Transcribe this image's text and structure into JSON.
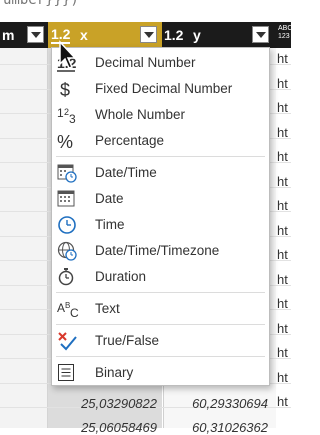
{
  "formula_fragment": "umber}}})",
  "header": {
    "left_col_label": "m",
    "x_col": {
      "type_badge": "1.2",
      "label": "x"
    },
    "y_col": {
      "type_badge": "1.2",
      "label": "y"
    },
    "url_col_badge_top": "ABC",
    "url_col_badge_bottom": "123"
  },
  "rows": {
    "cell_prefix": "ht",
    "bottom_rows": [
      {
        "x": "25,03290822",
        "y": "60,29330694"
      },
      {
        "x": "25,06058469",
        "y": "60,31026362"
      }
    ]
  },
  "menu": {
    "items": [
      {
        "label": "Decimal Number",
        "icon": "decimal-number-icon"
      },
      {
        "label": "Fixed Decimal Number",
        "icon": "fixed-decimal-icon"
      },
      {
        "label": "Whole Number",
        "icon": "whole-number-icon"
      },
      {
        "label": "Percentage",
        "icon": "percentage-icon"
      },
      {
        "label": "Date/Time",
        "icon": "datetime-icon"
      },
      {
        "label": "Date",
        "icon": "date-icon"
      },
      {
        "label": "Time",
        "icon": "time-icon"
      },
      {
        "label": "Date/Time/Timezone",
        "icon": "datetime-timezone-icon"
      },
      {
        "label": "Duration",
        "icon": "duration-icon"
      },
      {
        "label": "Text",
        "icon": "text-icon"
      },
      {
        "label": "True/False",
        "icon": "true-false-icon"
      },
      {
        "label": "Binary",
        "icon": "binary-icon"
      }
    ]
  },
  "colors": {
    "header_bg": "#1b1b1b",
    "selected_column": "#c9a227",
    "menu_icon_blue": "#1f6fc0",
    "menu_icon_red": "#d9392c"
  }
}
